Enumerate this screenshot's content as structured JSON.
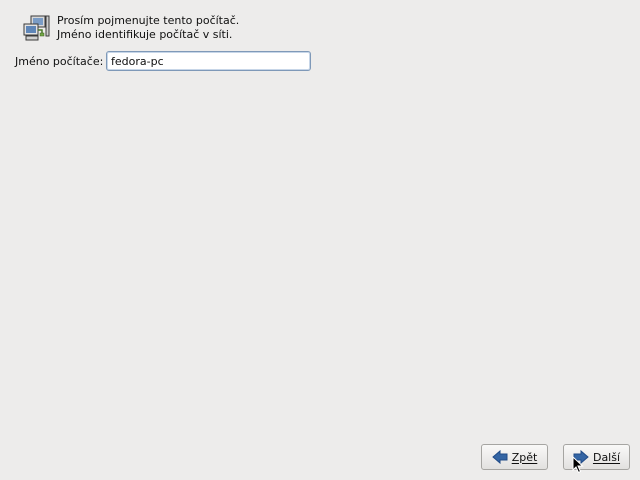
{
  "header": {
    "icon": "network-computer-icon",
    "line1": "Prosím pojmenujte tento počítač.",
    "line2": "Jméno identifikuje počítač v síti."
  },
  "hostname": {
    "label": "Jméno počítače:",
    "value": "fedora-pc"
  },
  "buttons": {
    "back": {
      "label": "Zpět",
      "mnemonic": "Z",
      "icon": "arrow-left-icon"
    },
    "next": {
      "label": "Další",
      "mnemonic": "D",
      "icon": "arrow-right-icon"
    }
  },
  "colors": {
    "background": "#edeceb",
    "arrow_blue": "#3465a4",
    "input_border": "#7f99b8"
  }
}
